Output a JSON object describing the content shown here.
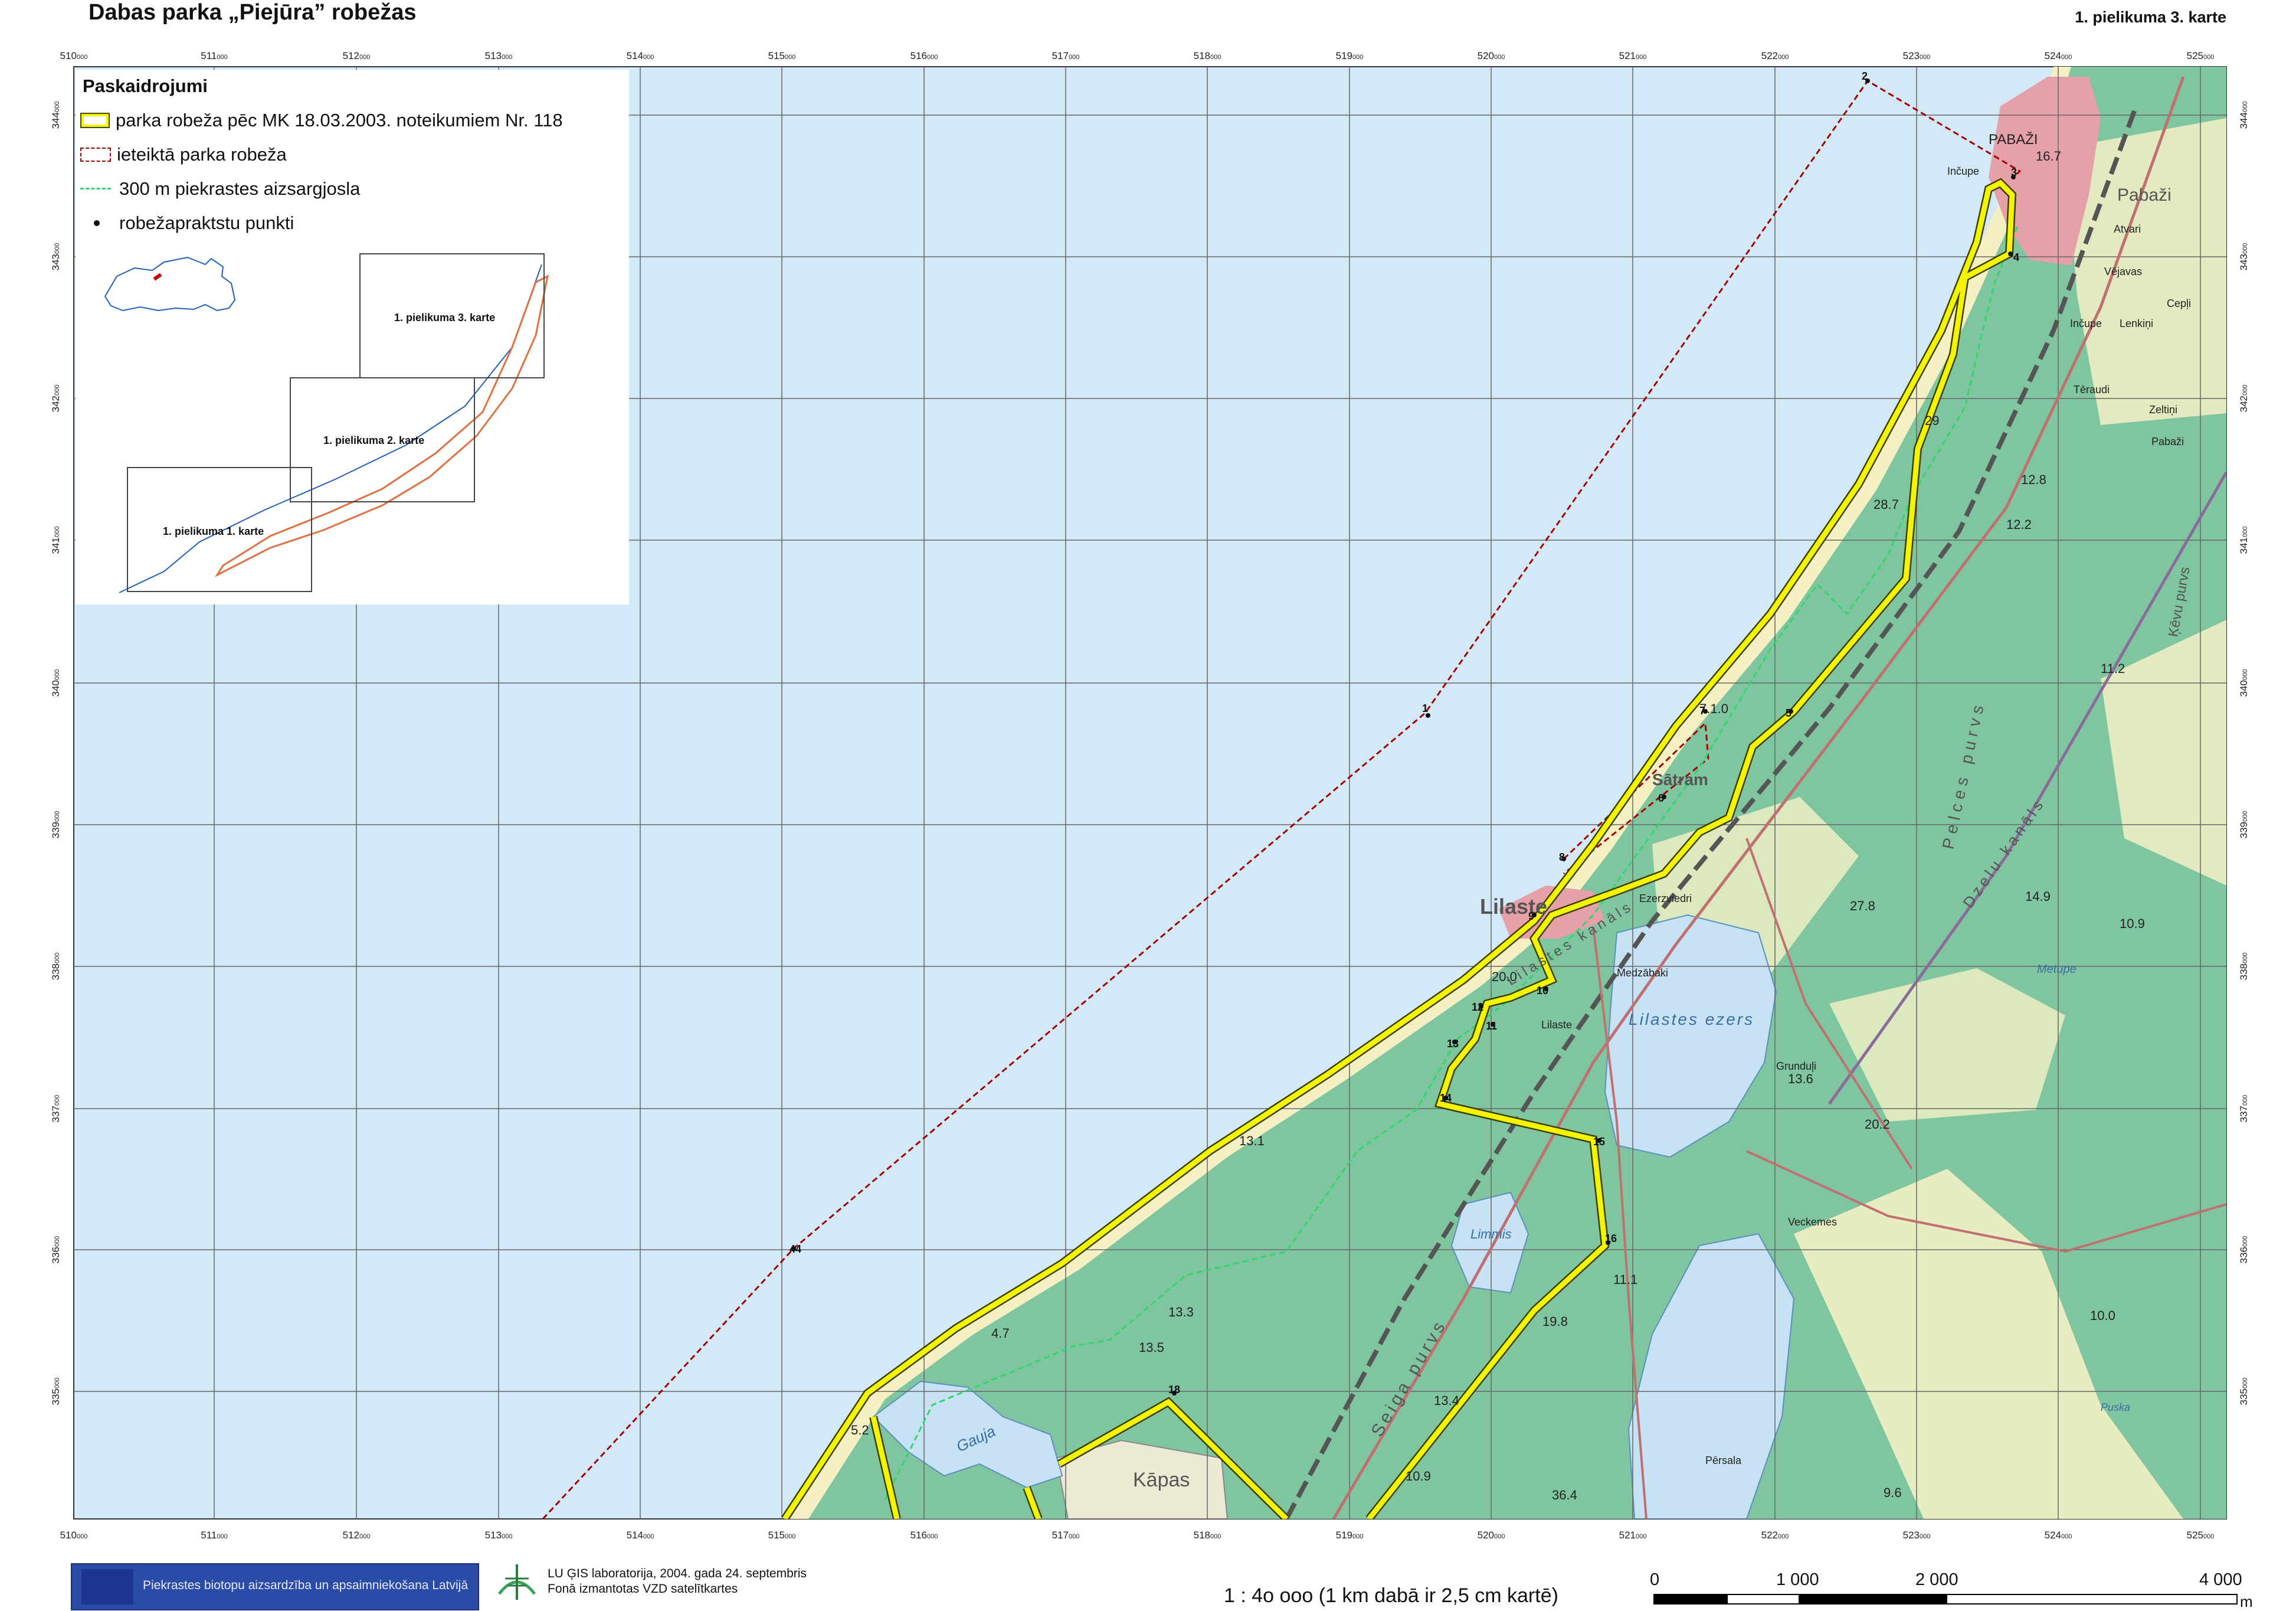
{
  "header": {
    "title": "Dabas parka „Piejūra” robežas",
    "sheet_label": "1. pielikuma 3. karte"
  },
  "legend": {
    "title": "Paskaidrojumi",
    "items": [
      {
        "label": "parka  robeža pēc MK 18.03.2003. noteikumiem Nr. 118",
        "symbol": "yellow-boundary",
        "color": "#f3f400"
      },
      {
        "label": "ieteiktā parka robeža",
        "symbol": "red-dashed-boundary",
        "color": "#a30000"
      },
      {
        "label": "300 m piekrastes aizsargjosla",
        "symbol": "green-dashed-line",
        "color": "#2fd86a"
      },
      {
        "label": "robežapraktstu punkti",
        "symbol": "black-dot",
        "color": "#111111"
      }
    ],
    "inset": {
      "sheet_labels": [
        "1. pielikuma 3. karte",
        "1. pielikuma 2. karte",
        "1. pielikuma 1. karte"
      ]
    }
  },
  "grid": {
    "x_labels": [
      "510",
      "511",
      "512",
      "513",
      "514",
      "515",
      "516",
      "517",
      "518",
      "519",
      "520",
      "521",
      "522",
      "523",
      "524",
      "525"
    ],
    "x_suffix": "000",
    "y_labels": [
      "344",
      "343",
      "342",
      "341",
      "340",
      "339",
      "338",
      "337",
      "336",
      "335"
    ],
    "y_suffix": "000"
  },
  "points": [
    "1",
    "2",
    "3",
    "4",
    "5",
    "6",
    "7",
    "8",
    "9",
    "10",
    "11",
    "12",
    "13",
    "14",
    "15",
    "16",
    "18",
    "44"
  ],
  "place_names": {
    "pabazi_town": "PABAŽI",
    "pabazi": "Pabaži",
    "lilaste": "Lilaste",
    "lilaste_small": "Lilaste",
    "lilastes_ezers": "Lilastes ezers",
    "kapas": "Kāpas",
    "gauja": "Gauja",
    "limmis": "Limmis",
    "saulkrasti_part": "Sātram",
    "atvari": "Atvari",
    "vejavas": "Vējavas",
    "incupe": "Inčupe",
    "incupe2": "Inčupe",
    "lenkini": "Lenkiņi",
    "teraudi": "Tēraudi",
    "zeltipi": "Zeltiņi",
    "pabazi2": "Pabaži",
    "ceplis": "Cepļi",
    "ezerzviedri": "Ezerzviedri",
    "medzabaki": "Medzābaki",
    "grundulji": "Grunduļi",
    "veckemes": "Veckemes",
    "persala": "Pērsala",
    "metupe": "Metupe",
    "seiga_purvs": "Seiga purvs",
    "kevu_purvs": "Ķēvu purvs",
    "pelces_purvs": "Pelces purvs",
    "dzelu_kanals": "Dzelu kanāls",
    "lilastes_kanals": "Lilastes kanāls",
    "pulka": "Puska"
  },
  "elevations": [
    "16.7",
    "12.8",
    "12.2",
    "28.7",
    "29",
    "11.2",
    "14.9",
    "10.9",
    "27.8",
    "13.6",
    "20.2",
    "13.1",
    "13.3",
    "13.5",
    "4.7",
    "5.2",
    "11.1",
    "19.8",
    "13.4",
    "10.9",
    "36.4",
    "9.6",
    "10.0",
    "20.0",
    "7.1.0"
  ],
  "footer": {
    "credit_1": "LU ĢIS laboratorija, 2004. gada 24. septembris",
    "credit_2": "Fonā izmantotas VZD satelītkartes",
    "project_label": "Piekrastes biotopu aizsardzība un apsaimniekošana Latvijā",
    "scale_text": "1 : 4o ooo (1 km dabā ir 2,5 cm kartē)",
    "scale_ticks": [
      "0",
      "1 000",
      "2 000",
      "4 000"
    ],
    "scale_unit": "m"
  },
  "colors": {
    "sea": "#d4e9f7",
    "forest": "#7fc6a0",
    "beach": "#f4f0c4",
    "boundary_yellow": "#f3f400",
    "boundary_red": "#a30000",
    "coastal_green": "#2fd86a",
    "urban": "#e5a0a8"
  }
}
